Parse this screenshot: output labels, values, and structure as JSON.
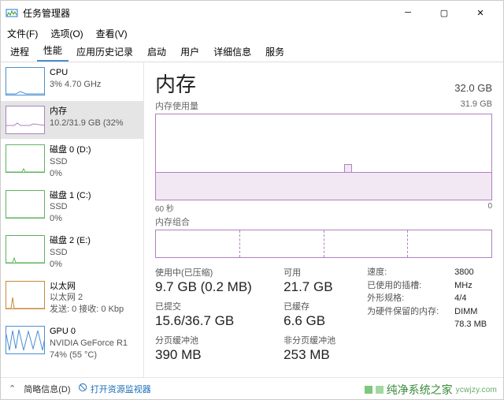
{
  "title": "任务管理器",
  "menu": {
    "file": "文件(F)",
    "options": "选项(O)",
    "view": "查看(V)"
  },
  "tabs": {
    "processes": "进程",
    "performance": "性能",
    "apphistory": "应用历史记录",
    "startup": "启动",
    "users": "用户",
    "details": "详细信息",
    "services": "服务"
  },
  "sidebar": [
    {
      "name": "CPU",
      "l2": "3%  4.70 GHz"
    },
    {
      "name": "内存",
      "l2": "10.2/31.9 GB (32%"
    },
    {
      "name": "磁盘 0 (D:)",
      "l2": "SSD",
      "l3": "0%"
    },
    {
      "name": "磁盘 1 (C:)",
      "l2": "SSD",
      "l3": "0%"
    },
    {
      "name": "磁盘 2 (E:)",
      "l2": "SSD",
      "l3": "0%"
    },
    {
      "name": "以太网",
      "l2": "以太网 2",
      "l3": "发送: 0  接收: 0 Kbp"
    },
    {
      "name": "GPU 0",
      "l2": "NVIDIA GeForce R1",
      "l3": "74%  (55 °C)"
    }
  ],
  "header": {
    "title": "内存",
    "capacity": "32.0 GB"
  },
  "usage": {
    "label": "内存使用量",
    "max": "31.9 GB"
  },
  "axis": {
    "left": "60 秒",
    "right": "0"
  },
  "comp": {
    "label": "内存组合"
  },
  "metrics": {
    "inuse_l": "使用中(已压缩)",
    "inuse_v": "9.7 GB (0.2 MB)",
    "avail_l": "可用",
    "avail_v": "21.7 GB",
    "commit_l": "已提交",
    "commit_v": "15.6/36.7 GB",
    "cached_l": "已缓存",
    "cached_v": "6.6 GB",
    "paged_l": "分页缓冲池",
    "paged_v": "390 MB",
    "nonpaged_l": "非分页缓冲池",
    "nonpaged_v": "253 MB"
  },
  "specs": {
    "speed_l": "速度:",
    "speed_v": "3800 MHz",
    "slots_l": "已使用的插槽:",
    "slots_v": "4/4",
    "form_l": "外形规格:",
    "form_v": "DIMM",
    "hw_l": "为硬件保留的内存:",
    "hw_v": "78.3 MB"
  },
  "status": {
    "brief": "简略信息(D)",
    "open": "打开资源监视器"
  },
  "watermark": {
    "name": "纯净系统之家",
    "url": "ycwjzy.com"
  },
  "chart_data": {
    "type": "area",
    "title": "内存使用量",
    "ylabel": "GB",
    "ylim": [
      0,
      31.9
    ],
    "xlabel": "秒",
    "xlim": [
      60,
      0
    ],
    "series": [
      {
        "name": "使用中",
        "values_gb": [
          10.1,
          10.1,
          10.1,
          10.1,
          10.1,
          10.2,
          10.2,
          10.2,
          10.2,
          10.2,
          10.2,
          10.2,
          10.2,
          10.2,
          10.3,
          10.5,
          12.0,
          10.5,
          10.3,
          10.2,
          10.2,
          10.2,
          10.2,
          10.2,
          10.2,
          10.2,
          10.2,
          10.2,
          10.2,
          10.2
        ]
      }
    ]
  }
}
